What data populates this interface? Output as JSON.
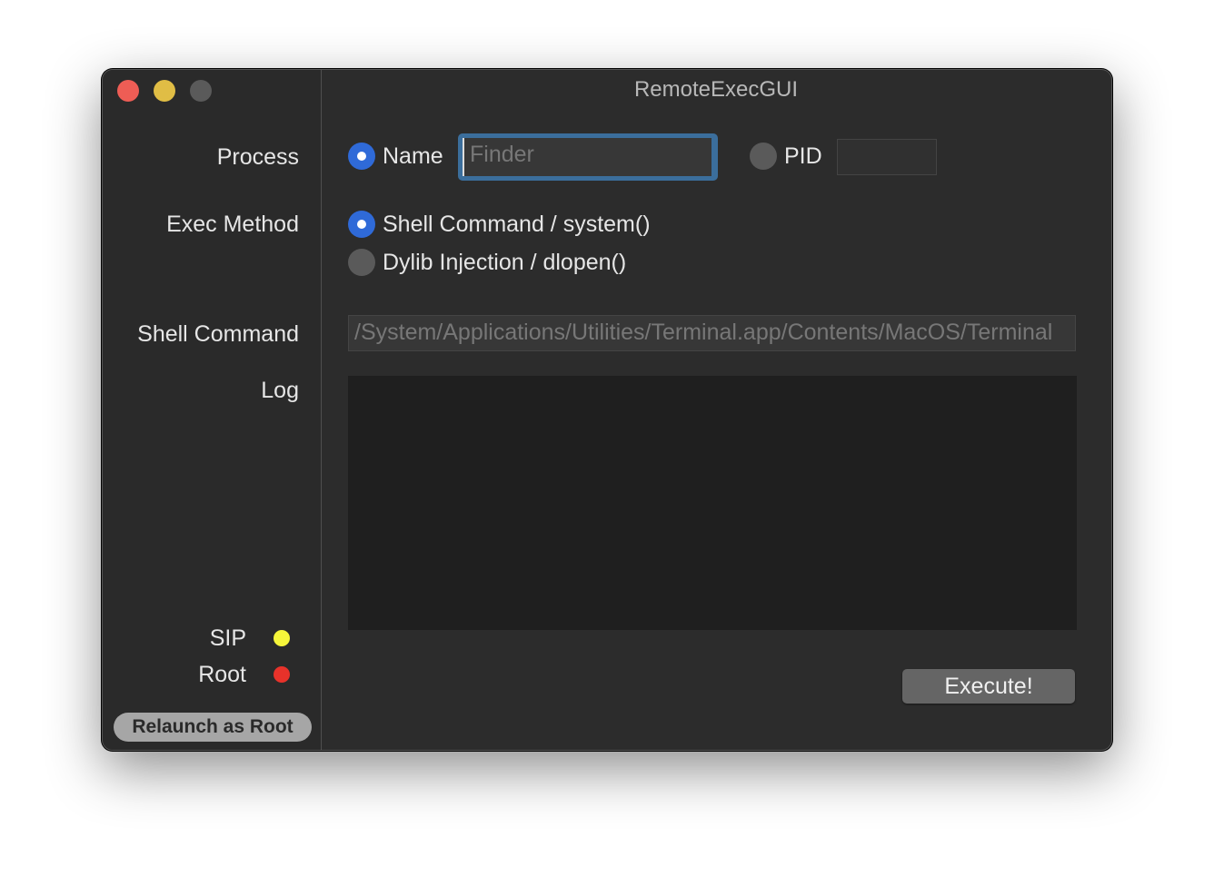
{
  "window": {
    "title": "RemoteExecGUI"
  },
  "sidebar": {
    "process_label": "Process",
    "exec_method_label": "Exec Method",
    "shell_command_label": "Shell Command",
    "log_label": "Log",
    "sip_label": "SIP",
    "root_label": "Root",
    "sip_status_color": "#f5f53a",
    "root_status_color": "#e8322a",
    "relaunch_button": "Relaunch as Root"
  },
  "process": {
    "name_option": "Name",
    "name_selected": true,
    "name_value": "",
    "name_placeholder": "Finder",
    "pid_option": "PID",
    "pid_selected": false,
    "pid_value": ""
  },
  "exec_method": {
    "options": [
      {
        "label": "Shell Command / system()",
        "selected": true
      },
      {
        "label": "Dylib Injection / dlopen()",
        "selected": false
      }
    ]
  },
  "shell_command": {
    "placeholder": "/System/Applications/Utilities/Terminal.app/Contents/MacOS/Terminal"
  },
  "log": {
    "content": ""
  },
  "execute_button": "Execute!",
  "colors": {
    "accent": "#2f6ad8",
    "focus_ring": "#3b6e9c"
  }
}
